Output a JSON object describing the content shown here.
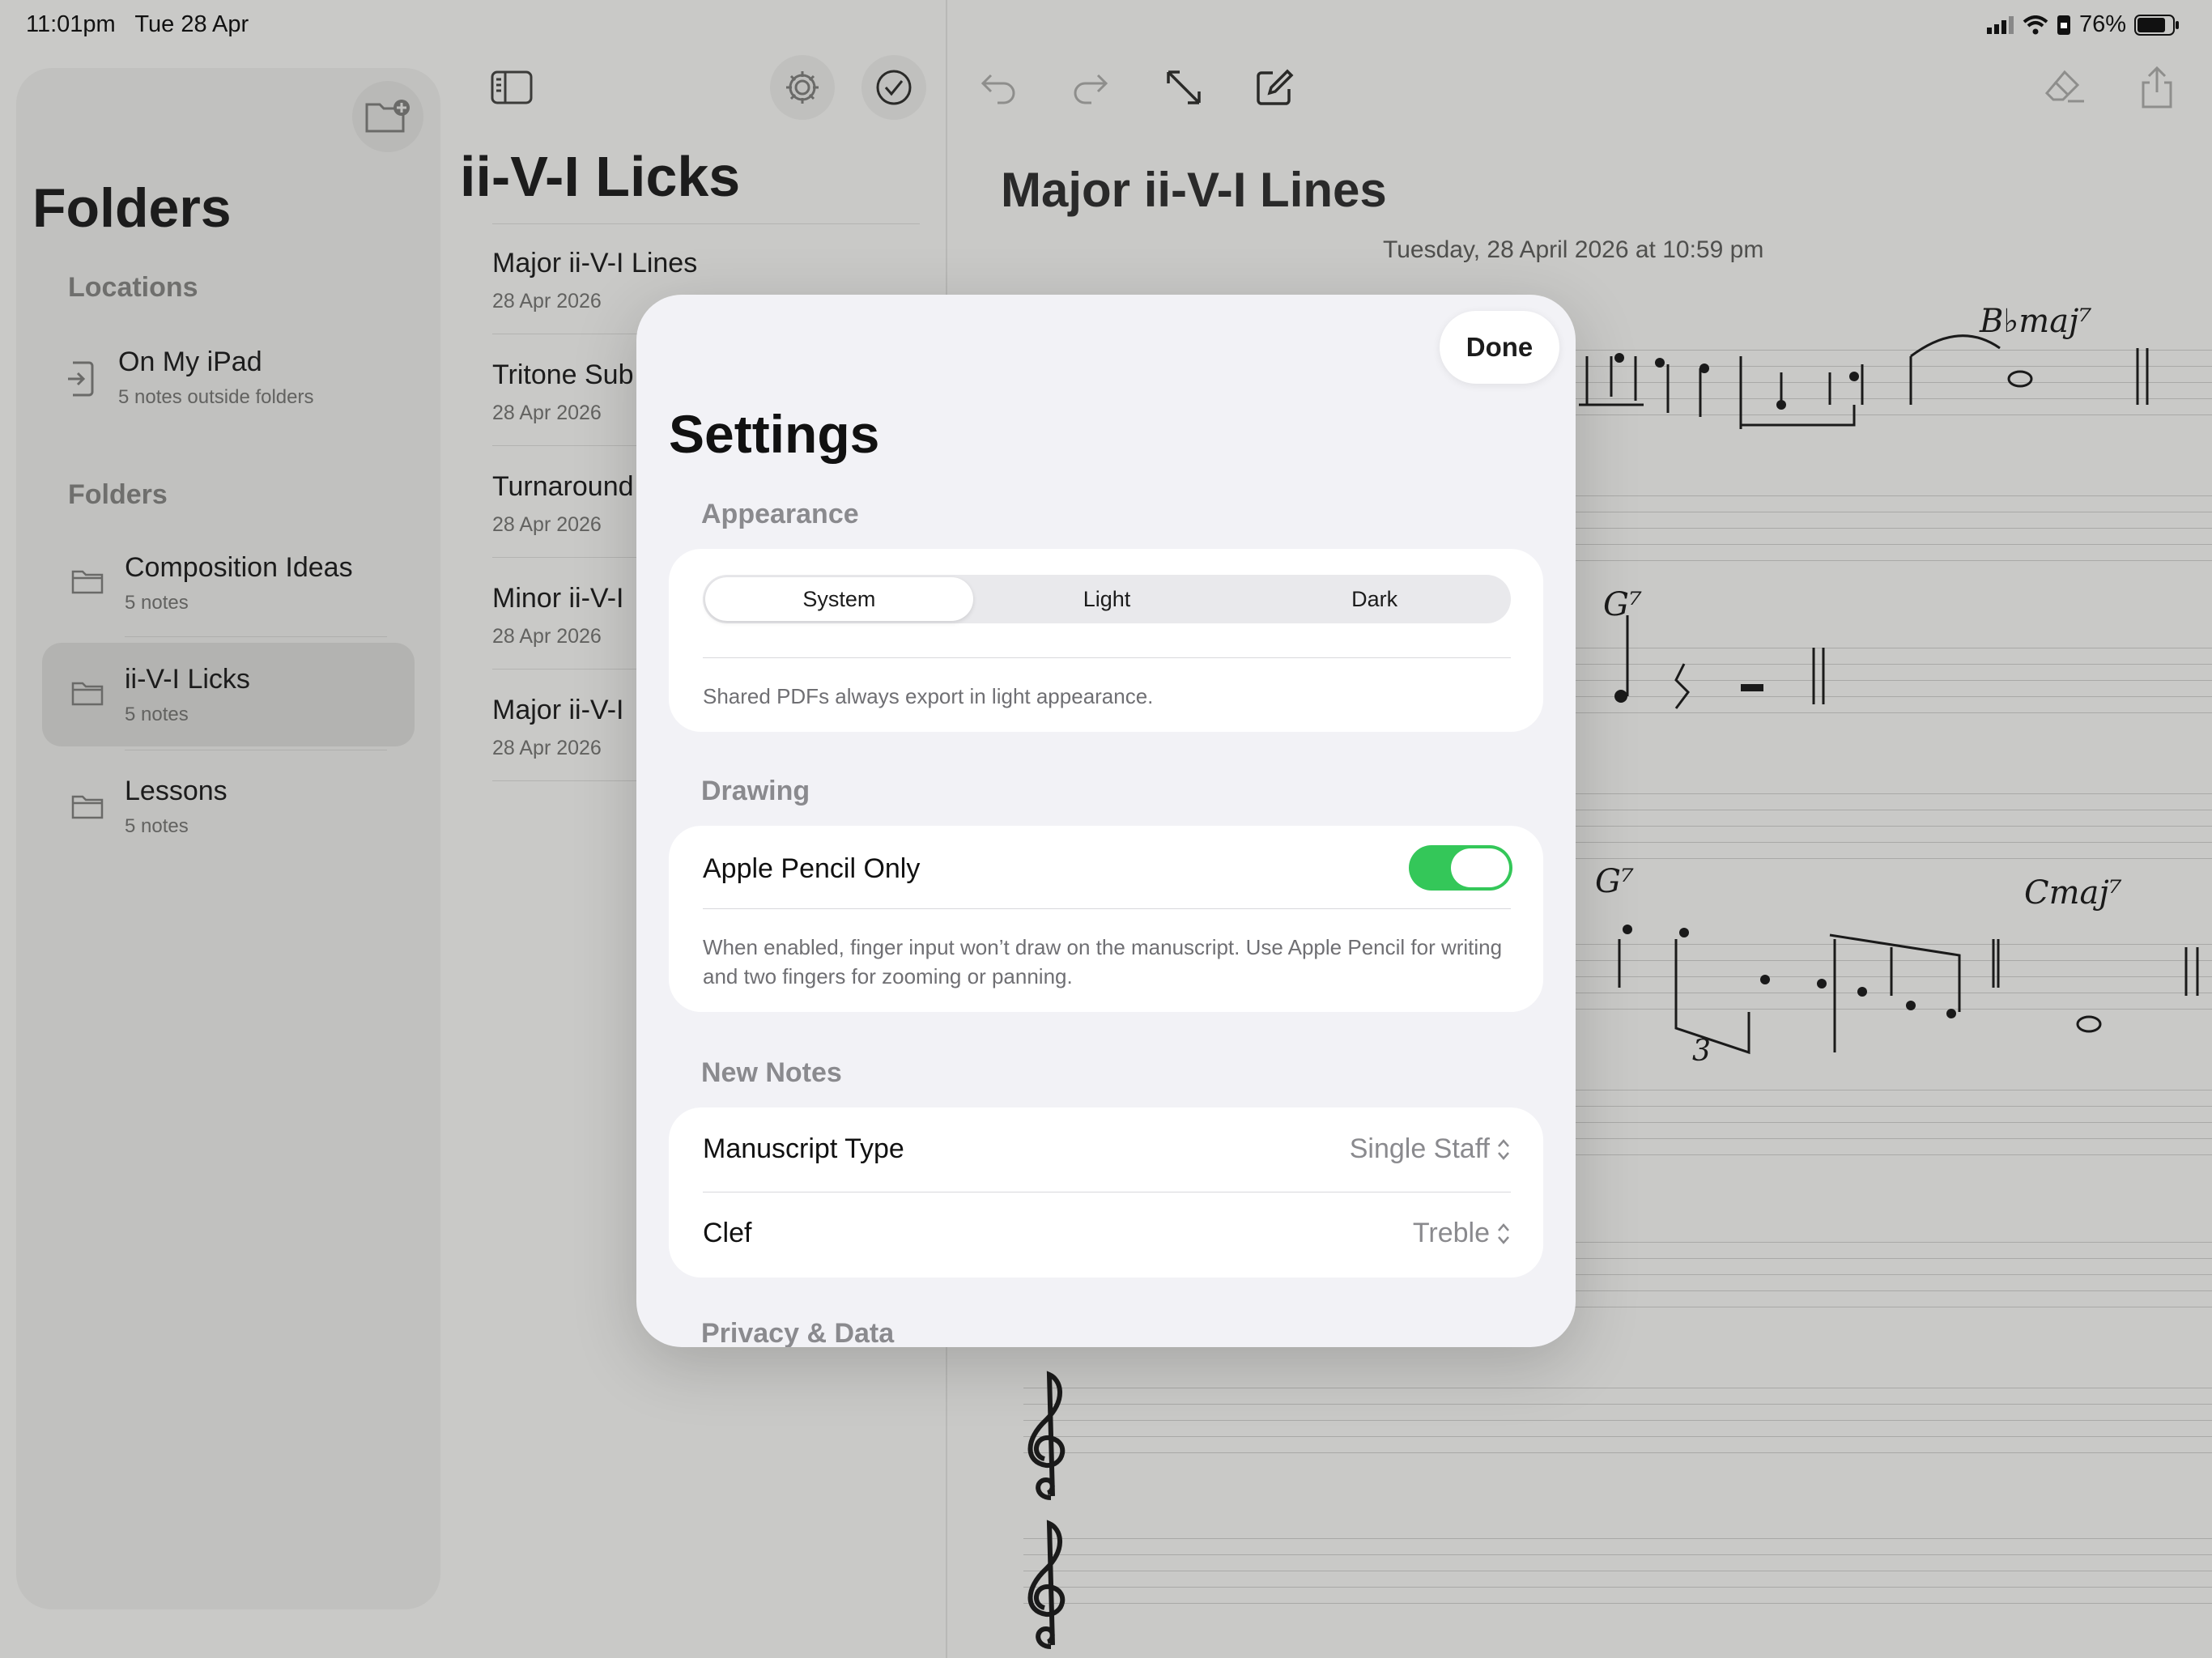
{
  "status_bar": {
    "time": "11:01pm",
    "date": "Tue 28 Apr",
    "battery": "76%"
  },
  "sidebar": {
    "title": "Folders",
    "locations_header": "Locations",
    "location": {
      "title": "On My iPad",
      "subtitle": "5 notes outside folders"
    },
    "folders_header": "Folders",
    "folders": [
      {
        "title": "Composition Ideas",
        "subtitle": "5 notes"
      },
      {
        "title": "ii-V-I Licks",
        "subtitle": "5 notes"
      },
      {
        "title": "Lessons",
        "subtitle": "5 notes"
      }
    ]
  },
  "note_list": {
    "title": "ii-V-I Licks",
    "notes": [
      {
        "title": "Major ii-V-I Lines",
        "date": "28 Apr 2026"
      },
      {
        "title": "Tritone Sub",
        "date": "28 Apr 2026"
      },
      {
        "title": "Turnaround",
        "date": "28 Apr 2026"
      },
      {
        "title": "Minor ii-V-I",
        "date": "28 Apr 2026"
      },
      {
        "title": "Major ii-V-I",
        "date": "28 Apr 2026"
      }
    ]
  },
  "document": {
    "title": "Major ii-V-I Lines",
    "date": "Tuesday, 28 April 2026 at 10:59 pm",
    "handwriting": {
      "chord1": "B♭maj⁷",
      "chord2": "G⁷",
      "chord3": "G⁷",
      "chord4": "Cmaj⁷",
      "triplet": "3"
    }
  },
  "settings": {
    "title": "Settings",
    "done_label": "Done",
    "appearance": {
      "header": "Appearance",
      "options": [
        "System",
        "Light",
        "Dark"
      ],
      "selected": "System",
      "footnote": "Shared PDFs always export in light appearance."
    },
    "drawing": {
      "header": "Drawing",
      "pencil_label": "Apple Pencil Only",
      "pencil_on": true,
      "footnote": "When enabled, finger input won’t draw on the manuscript. Use Apple Pencil for writing and two fingers for zooming or panning."
    },
    "new_notes": {
      "header": "New Notes",
      "manuscript_label": "Manuscript Type",
      "manuscript_value": "Single Staff",
      "clef_label": "Clef",
      "clef_value": "Treble"
    },
    "privacy_header": "Privacy & Data"
  },
  "icons": {
    "toggle_sidebar": "sidebar-toggle-icon",
    "settings": "gear-icon",
    "select": "checkmark-circle-icon",
    "undo": "undo-icon",
    "redo": "redo-icon",
    "expand": "expand-icon",
    "compose": "compose-icon",
    "eraser": "eraser-icon",
    "share": "share-icon",
    "new_folder": "new-folder-icon"
  },
  "colors": {
    "toggle_on": "#34c759",
    "modal_bg": "#f2f2f6"
  }
}
